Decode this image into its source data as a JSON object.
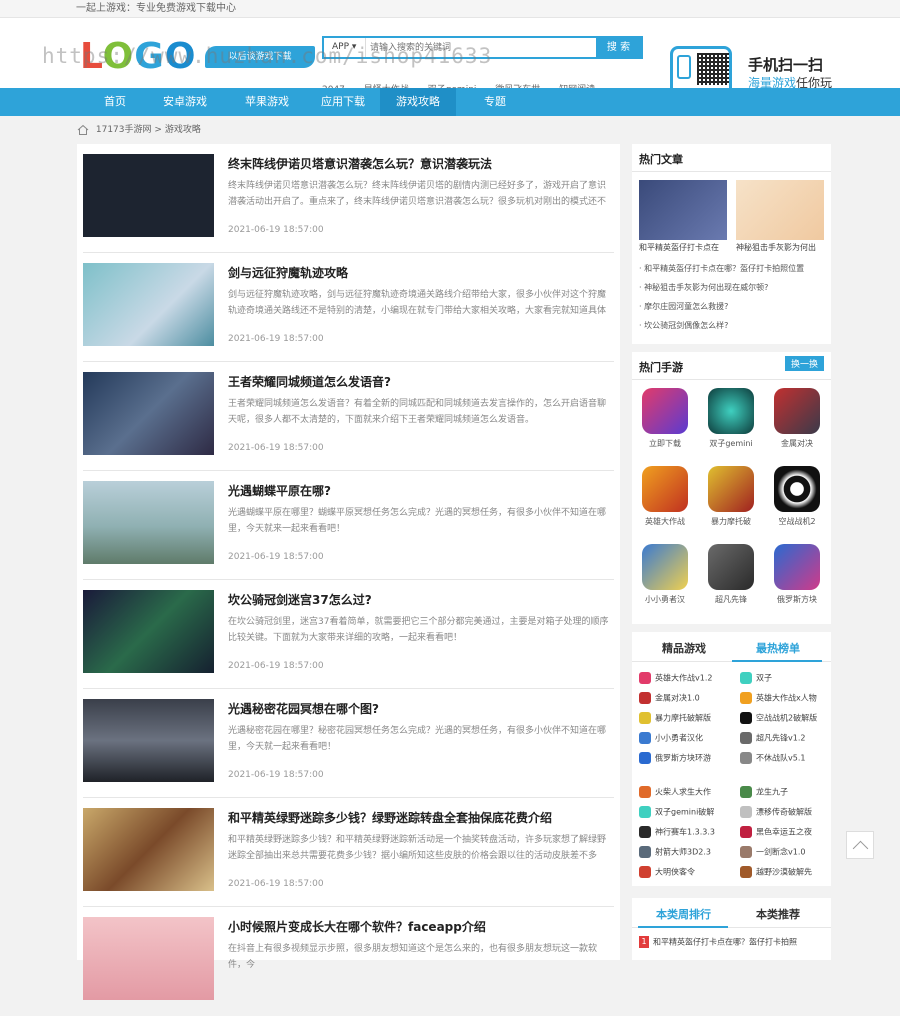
{
  "topbar": "一起上游戏：专业免费游戏下载中心",
  "logo": {
    "text": "LOGO",
    "slogan": "以后谈游戏下载"
  },
  "watermark": "https://www.huzhan.com/ishop41633",
  "search": {
    "select": "APP ▾",
    "placeholder": "请输入搜索的关键词",
    "button": "搜 索"
  },
  "hotkeys": [
    "2047",
    "星怪大作战",
    "双子gemini",
    "微风飞车世",
    "知网阅读"
  ],
  "scan": {
    "line1": "手机扫一扫",
    "line2a": "海量游戏",
    "line2b": "任你玩"
  },
  "nav": [
    "首页",
    "安卓游戏",
    "苹果游戏",
    "应用下载",
    "游戏攻略",
    "专题"
  ],
  "breadcrumb": {
    "home": "17173手游网",
    "sep": ">",
    "current": "游戏攻略"
  },
  "articles": [
    {
      "title": "终末阵线伊诺贝塔意识潜袭怎么玩？意识潜袭玩法",
      "desc": "终末阵线伊诺贝塔意识潜袭怎么玩？终末阵线伊诺贝塔的剧情内测已经好多了，游戏开启了意识潜袭活动出开启了。重点来了，终末阵线伊诺贝塔意识潜袭怎么玩？很多玩机对刚出的模式还不",
      "time": "2021-06-19 18:57:00"
    },
    {
      "title": "剑与远征狩魔轨迹攻略",
      "desc": "剑与远征狩魔轨迹攻略，剑与远征狩魔轨迹奇境通关路线介绍带给大家，很多小伙伴对这个狩魔轨迹奇境通关路线还不是特别的清楚，小编现在就专门带给大家相关攻略，大家看完就知道具体",
      "time": "2021-06-19 18:57:00"
    },
    {
      "title": "王者荣耀同城频道怎么发语音?",
      "desc": "王者荣耀同城频道怎么发语音？有着全新的同城匹配和同城频道去发言操作的，怎么开启语音聊天呢，很多人都不太清楚的，下面就来介绍下王者荣耀同城频道怎么发语音。",
      "time": "2021-06-19 18:57:00"
    },
    {
      "title": "光遇蝴蝶平原在哪?",
      "desc": "光遇蝴蝶平原在哪里？蝴蝶平原冥想任务怎么完成？光遇的冥想任务，有很多小伙伴不知道在哪里，今天就来一起来看看吧！",
      "time": "2021-06-19 18:57:00"
    },
    {
      "title": "坎公骑冠剑迷宫37怎么过?",
      "desc": "在坎公骑冠剑里，迷宫37看着简单，就需要把它三个部分都完美通过，主要是对箱子处理的顺序比较关键。下面就为大家带来详细的攻略，一起来看看吧！",
      "time": "2021-06-19 18:57:00"
    },
    {
      "title": "光遇秘密花园冥想在哪个图?",
      "desc": "光遇秘密花园在哪里？秘密花园冥想任务怎么完成？光遇的冥想任务，有很多小伙伴不知道在哪里，今天就一起来看看吧！",
      "time": "2021-06-19 18:57:00"
    },
    {
      "title": "和平精英绿野迷踪多少钱？绿野迷踪转盘全套抽保底花费介绍",
      "desc": "和平精英绿野迷踪多少钱？和平精英绿野迷踪新活动是一个抽奖转盘活动，许多玩家想了解绿野迷踪全部抽出来总共需要花费多少钱？据小编所知这些皮肤的价格会跟以往的活动皮肤差不多",
      "time": "2021-06-19 18:57:00"
    },
    {
      "title": "小时候照片变成长大在哪个软件？faceapp介绍",
      "desc": "在抖音上有很多视频显示步照，很多朋友想知道这个是怎么来的，也有很多朋友想玩这一款软件，今",
      "time": ""
    }
  ],
  "hot_articles": {
    "title": "热门文章",
    "pics": [
      "和平精英盔仔打卡点在",
      "神秘狙击手灰影为何出"
    ],
    "list": [
      "· 和平精英盔仔打卡点在哪？盔仔打卡拍照位置",
      "· 神秘狙击手灰影为何出现在威尔顿?",
      "· 摩尔庄园河童怎么救援?",
      "· 坎公骑冠剑偶像怎么样?"
    ]
  },
  "hot_games": {
    "title": "热门手游",
    "more": "换一换",
    "items": [
      "立即下载",
      "双子gemini",
      "金属对决",
      "英雄大作战",
      "暴力摩托破",
      "空战战机2",
      "小小勇者汉",
      "超凡先锋",
      "俄罗斯方块"
    ]
  },
  "ranking": {
    "tab1": "精品游戏",
    "tab2": "最热榜单",
    "left": [
      "英雄大作战v1.2",
      "金属对决1.0",
      "暴力摩托破解版",
      "小小勇者汉化",
      "俄罗斯方块环游",
      "火柴人求生大作",
      "双子gemini破解",
      "神行赛车1.3.3.3",
      "射箭大师3D2.3",
      "大明侠客令"
    ],
    "right": [
      "双子",
      "英雄大作战x人物",
      "空战战机2破解版",
      "超凡先锋v1.2",
      "不休战队v5.1",
      "龙生九子",
      "漂移传奇破解版",
      "黑色幸运五之夜",
      "一剑断念v1.0",
      "越野沙漠破解先"
    ]
  },
  "bottom_box": {
    "tab1": "本类周排行",
    "tab2": "本类推荐",
    "first": "和平精英盔仔打卡点在哪？盔仔打卡拍照",
    "num": "1"
  }
}
